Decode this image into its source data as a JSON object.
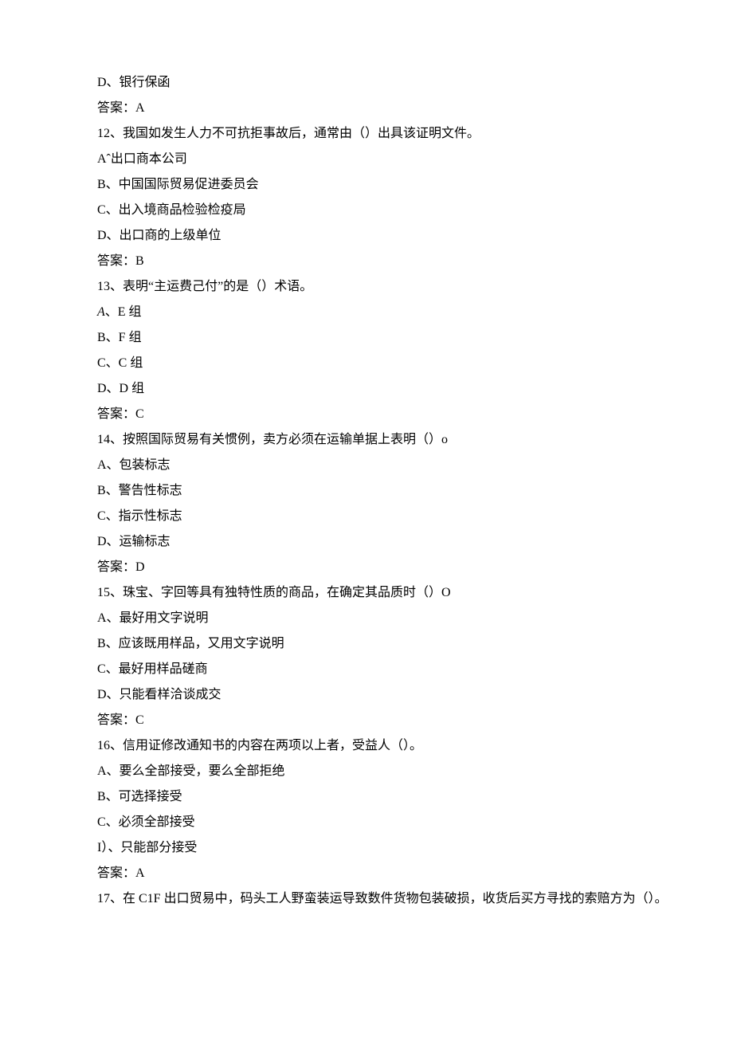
{
  "lines": [
    {
      "cls": "indent1",
      "text": "D、银行保函"
    },
    {
      "cls": "indent1",
      "text": "答案：A"
    },
    {
      "cls": "indent1",
      "text": "12、我国如发生人力不可抗拒事故后，通常由（）出具该证明文件。"
    },
    {
      "cls": "indent1",
      "text": "Aˆ出口商本公司"
    },
    {
      "cls": "indent1",
      "text": "B、中国国际贸易促进委员会"
    },
    {
      "cls": "indent1",
      "text": "C、出入境商品检验检疫局"
    },
    {
      "cls": "indent1",
      "text": "D、出口商的上级单位"
    },
    {
      "cls": "indent1",
      "text": "答案：B"
    },
    {
      "cls": "indent1",
      "text": "13、表明“主运费己付”的是（）术语。"
    },
    {
      "cls": "indent1",
      "text": "A、E 组",
      "leadItalic": "A"
    },
    {
      "cls": "indent1",
      "text": "B、F 组"
    },
    {
      "cls": "indent1",
      "text": "C、C 组"
    },
    {
      "cls": "indent1",
      "text": "D、D 组"
    },
    {
      "cls": "indent1",
      "text": "答案：C"
    },
    {
      "cls": "indent1",
      "text": "14、按照国际贸易有关惯例，卖方必须在运输单据上表明（）o"
    },
    {
      "cls": "indent1",
      "text": "A、包装标志"
    },
    {
      "cls": "indent1",
      "text": "B、警告性标志"
    },
    {
      "cls": "indent1",
      "text": "C、指示性标志"
    },
    {
      "cls": "indent1",
      "text": "D、运输标志"
    },
    {
      "cls": "indent1",
      "text": "答案：D"
    },
    {
      "cls": "indent1",
      "text": "15、珠宝、字回等具有独特性质的商品，在确定其品质时（）O"
    },
    {
      "cls": "indent1",
      "text": "A、最好用文字说明"
    },
    {
      "cls": "indent1",
      "text": "B、应该既用样品，又用文字说明"
    },
    {
      "cls": "indent1",
      "text": "C、最好用样品磋商"
    },
    {
      "cls": "indent1",
      "text": "D、只能看样洽谈成交"
    },
    {
      "cls": "indent1",
      "text": "答案：C"
    },
    {
      "cls": "indent1",
      "text": "16、信用证修改通知书的内容在两项以上者，受益人（）。"
    },
    {
      "cls": "indent1",
      "text": "A、要么全部接受，要么全部拒绝"
    },
    {
      "cls": "indent1",
      "text": "B、可选择接受"
    },
    {
      "cls": "indent1",
      "text": "C、必须全部接受"
    },
    {
      "cls": "indent1",
      "text": "I）、只能部分接受"
    },
    {
      "cls": "indent1",
      "text": "答案：A"
    },
    {
      "cls": "indent1",
      "text": "17、在 C1F 出口贸易中，码头工人野蛮装运导致数件货物包装破损，收货后买方寻找的索赔方为（）。"
    }
  ]
}
